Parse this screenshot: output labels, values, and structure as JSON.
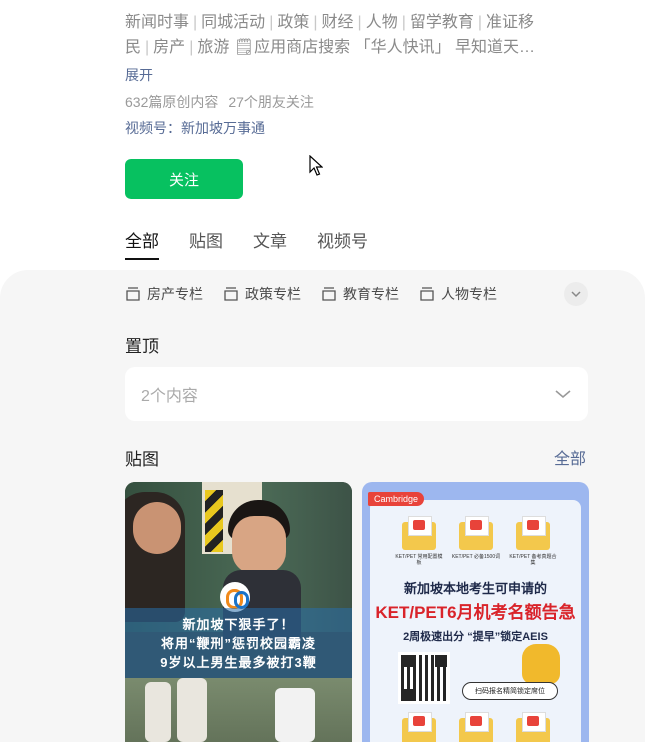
{
  "profile": {
    "description_line1": [
      "新闻时事",
      "同城活动",
      "政策",
      "财经",
      "人物",
      "留学教育",
      "准证移"
    ],
    "description_line2_prefix": [
      "民",
      "房产",
      "旅游"
    ],
    "description_line2_suffix": "🗒应用商店搜索 「华人快讯」 早知道天…",
    "expand_label": "展开",
    "original_count": "632篇原创内容",
    "friends_following": "27个朋友关注",
    "channel": "视频号：新加坡万事通",
    "follow_label": "关注"
  },
  "tabs": [
    {
      "label": "全部",
      "active": true
    },
    {
      "label": "贴图",
      "active": false
    },
    {
      "label": "文章",
      "active": false
    },
    {
      "label": "视频号",
      "active": false
    }
  ],
  "columns": [
    {
      "label": "房产专栏",
      "icon": "column-icon"
    },
    {
      "label": "政策专栏",
      "icon": "column-icon"
    },
    {
      "label": "教育专栏",
      "icon": "column-icon"
    },
    {
      "label": "人物专栏",
      "icon": "column-icon"
    }
  ],
  "pinned": {
    "title": "置顶",
    "summary": "2个内容"
  },
  "posts": {
    "title": "贴图",
    "all_label": "全部",
    "card1": {
      "line1": "新加坡下狠手了！",
      "line2": "将用“鞭刑”惩罚校园霸凌",
      "line3": "9岁以上男生最多被打3鞭"
    },
    "card2": {
      "brand": "Cambridge",
      "folder_labels": [
        "KET/PET 常用配置模板",
        "KET/PET 必备1500词",
        "KET/PET 备考真题合集"
      ],
      "line1": "新加坡本地考生可申请的",
      "line2": "KET/PET6月机考名额告急",
      "line3": "2周极速出分 “提早”锁定AEIS",
      "cta": "扫码报名精简锁定席位"
    }
  },
  "colors": {
    "accent_green": "#07c160",
    "link_blue": "#576b95"
  }
}
